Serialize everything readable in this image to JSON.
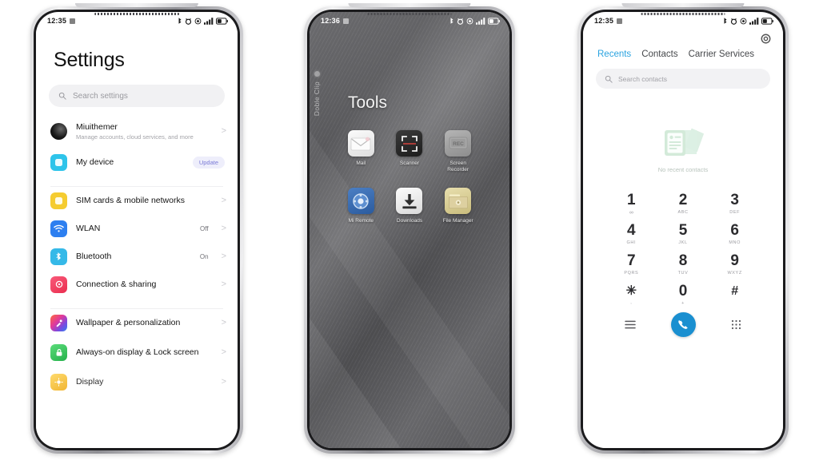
{
  "phones": [
    {
      "id": "settings-phone",
      "status_bar": {
        "time": "12:35",
        "icons": [
          "bluetooth-icon",
          "alarm-icon",
          "dnd-icon",
          "signal-icon",
          "battery-icon"
        ]
      },
      "app": "settings",
      "title": "Settings",
      "search": {
        "placeholder": "Search settings",
        "icon": "search-icon"
      },
      "items": [
        {
          "label": "Miuithemer",
          "sub": "Manage accounts, cloud services, and more",
          "icon": "account-avatar",
          "color": "#141414",
          "chevron": ">"
        },
        {
          "label": "My device",
          "sub": "",
          "icon": "device-icon",
          "color": "#2ec4ea",
          "badge": "Update"
        },
        {
          "label": "SIM cards & mobile networks",
          "sub": "",
          "icon": "sim-icon",
          "color": "#f5cc30",
          "chevron": ">"
        },
        {
          "label": "WLAN",
          "sub": "",
          "icon": "wifi-icon",
          "color": "#2d7ff0",
          "value": "Off",
          "chevron": ">"
        },
        {
          "label": "Bluetooth",
          "sub": "",
          "icon": "bluetooth-icon",
          "color": "#35b9e8",
          "value": "On",
          "chevron": ">"
        },
        {
          "label": "Connection & sharing",
          "sub": "",
          "icon": "connection-icon",
          "color": "#f0435c",
          "chevron": ">"
        },
        {
          "label": "Wallpaper & personalization",
          "sub": "",
          "icon": "wallpaper-icon",
          "color": "#b14ad8",
          "chevron": ">"
        },
        {
          "label": "Always-on display & Lock screen",
          "sub": "",
          "icon": "lock-icon",
          "color": "#3cc35a",
          "chevron": ">"
        },
        {
          "label": "Display",
          "sub": "",
          "icon": "display-icon",
          "color": "#f5c026",
          "chevron": ">"
        }
      ]
    },
    {
      "id": "tools-phone",
      "status_bar": {
        "time": "12:36",
        "icons": [
          "bluetooth-icon",
          "alarm-icon",
          "dnd-icon",
          "signal-icon",
          "battery-icon"
        ]
      },
      "app": "home-folder",
      "side_widget": {
        "label": "Doble Clip",
        "icon": "clip-dot-icon"
      },
      "folder_title": "Tools",
      "apps": [
        {
          "name": "Mail",
          "icon": "mail-icon",
          "tile": "t-mail"
        },
        {
          "name": "Scanner",
          "icon": "scanner-icon",
          "tile": "t-scanner"
        },
        {
          "name": "Screen Recorder",
          "icon": "screen-recorder-icon",
          "tile": "t-rec"
        },
        {
          "name": "Mi Remote",
          "icon": "remote-icon",
          "tile": "t-remote"
        },
        {
          "name": "Downloads",
          "icon": "download-icon",
          "tile": "t-dl"
        },
        {
          "name": "File Manager",
          "icon": "folder-icon",
          "tile": "t-fm"
        }
      ]
    },
    {
      "id": "dialer-phone",
      "status_bar": {
        "time": "12:35",
        "icons": [
          "bluetooth-icon",
          "alarm-icon",
          "dnd-icon",
          "signal-icon",
          "battery-icon"
        ]
      },
      "app": "dialer",
      "settings_icon": "gear-icon",
      "tabs": [
        {
          "label": "Recents",
          "active": true
        },
        {
          "label": "Contacts",
          "active": false
        },
        {
          "label": "Carrier Services",
          "active": false
        }
      ],
      "search": {
        "placeholder": "Search contacts",
        "icon": "search-icon"
      },
      "empty_state": {
        "label": "No recent contacts",
        "icon": "contact-cards-icon",
        "color": "#daeee2"
      },
      "keypad": [
        {
          "num": "1",
          "sub": "∞",
          "voicemail": true
        },
        {
          "num": "2",
          "sub": "ABC"
        },
        {
          "num": "3",
          "sub": "DEF"
        },
        {
          "num": "4",
          "sub": "GHI"
        },
        {
          "num": "5",
          "sub": "JKL"
        },
        {
          "num": "6",
          "sub": "MNO"
        },
        {
          "num": "7",
          "sub": "PQRS"
        },
        {
          "num": "8",
          "sub": "TUV"
        },
        {
          "num": "9",
          "sub": "WXYZ"
        },
        {
          "num": "✳",
          "sub": ","
        },
        {
          "num": "0",
          "sub": "+"
        },
        {
          "num": "#",
          "sub": ""
        }
      ],
      "actions": {
        "menu_icon": "menu-icon",
        "call_icon": "phone-call-icon",
        "keypad_icon": "keypad-icon",
        "accent": "#1a8fd0"
      }
    }
  ]
}
